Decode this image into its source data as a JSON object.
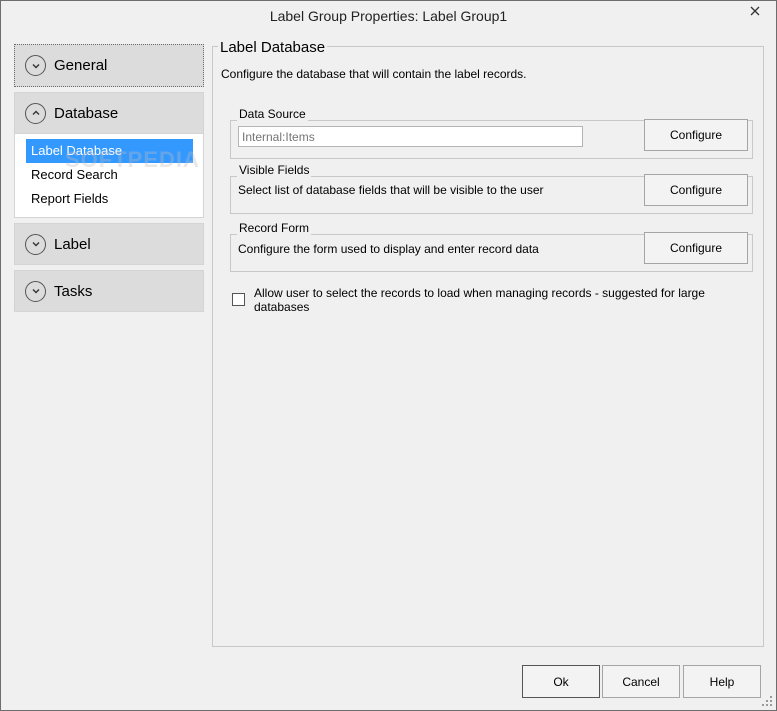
{
  "window": {
    "title": "Label Group Properties: Label Group1"
  },
  "nav": {
    "general": "General",
    "database": "Database",
    "database_items": [
      "Label Database",
      "Record Search",
      "Report Fields"
    ],
    "label": "Label",
    "tasks": "Tasks",
    "watermark": "SOFTPEDIA"
  },
  "panel": {
    "title": "Label Database",
    "description": "Configure the database that will contain the label records.",
    "data_source": {
      "legend": "Data Source",
      "value": "",
      "placeholder": "Internal:Items",
      "button": "Configure"
    },
    "visible_fields": {
      "legend": "Visible Fields",
      "text": "Select list of database fields that will be visible to the user",
      "button": "Configure"
    },
    "record_form": {
      "legend": "Record Form",
      "text": "Configure the form used to display and enter record data",
      "button": "Configure"
    },
    "checkbox_label": "Allow user to select the records to load when managing records - suggested for large databases",
    "checkbox_checked": false
  },
  "footer": {
    "ok": "Ok",
    "cancel": "Cancel",
    "help": "Help"
  },
  "colors": {
    "selection": "#3399ff",
    "nav_header": "#dcdcdc",
    "background": "#f0f0f0"
  }
}
